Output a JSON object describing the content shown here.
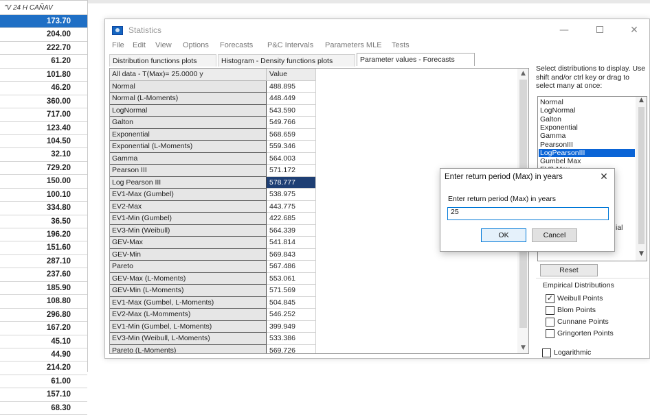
{
  "sheet": {
    "header": "\"V 24 H CAÑAV",
    "cells": [
      "173.70",
      "204.00",
      "222.70",
      "61.20",
      "101.80",
      "46.20",
      "360.00",
      "717.00",
      "123.40",
      "104.50",
      "32.10",
      "729.20",
      "150.00",
      "100.10",
      "334.80",
      "36.50",
      "196.20",
      "151.60",
      "287.10",
      "237.60",
      "185.90",
      "108.80",
      "296.80",
      "167.20",
      "45.10",
      "44.90",
      "214.20",
      "61.00",
      "157.10",
      "68.30"
    ]
  },
  "window": {
    "title": "Statistics",
    "minimize": "—",
    "close": "✕"
  },
  "menu": [
    "File",
    "Edit",
    "View",
    "Options",
    "Forecasts",
    "P&C Intervals",
    "Parameters MLE",
    "Tests"
  ],
  "tabs": [
    "Distribution functions plots",
    "Histogram - Density functions plots",
    "Parameter values - Forecasts"
  ],
  "table": {
    "header_name": "All data - T(Max)= 25.0000 y",
    "header_value": "Value",
    "rows": [
      {
        "name": "Normal",
        "value": "488.895"
      },
      {
        "name": "Normal (L-Moments)",
        "value": "448.449"
      },
      {
        "name": "LogNormal",
        "value": "543.590"
      },
      {
        "name": "Galton",
        "value": "549.766"
      },
      {
        "name": "Exponential",
        "value": "568.659"
      },
      {
        "name": "Exponential (L-Moments)",
        "value": "559.346"
      },
      {
        "name": "Gamma",
        "value": "564.003"
      },
      {
        "name": "Pearson III",
        "value": "571.172"
      },
      {
        "name": "Log Pearson III",
        "value": "578.777"
      },
      {
        "name": "EV1-Max (Gumbel)",
        "value": "538.975"
      },
      {
        "name": "EV2-Max",
        "value": "443.775"
      },
      {
        "name": "EV1-Min (Gumbel)",
        "value": "422.685"
      },
      {
        "name": "EV3-Min (Weibull)",
        "value": "564.339"
      },
      {
        "name": "GEV-Max",
        "value": "541.814"
      },
      {
        "name": "GEV-Min",
        "value": "569.843"
      },
      {
        "name": "Pareto",
        "value": "567.486"
      },
      {
        "name": "GEV-Max (L-Moments)",
        "value": "553.061"
      },
      {
        "name": "GEV-Min (L-Moments)",
        "value": "571.569"
      },
      {
        "name": "EV1-Max (Gumbel, L-Moments)",
        "value": "504.845"
      },
      {
        "name": "EV2-Max (L-Momments)",
        "value": "546.252"
      },
      {
        "name": "EV1-Min (Gumbel, L-Moments)",
        "value": "399.949"
      },
      {
        "name": "EV3-Min (Weibull, L-Moments)",
        "value": "533.386"
      },
      {
        "name": "Pareto (L-Moments)",
        "value": "569.726"
      }
    ],
    "selected_row": "Log Pearson III"
  },
  "right": {
    "select_label": "Select distributions to display. Use shift and/or ctrl key or drag to select many at once:",
    "dist_list": [
      "Normal",
      "LogNormal",
      "Galton",
      "Exponential",
      "Gamma",
      "PearsonIII",
      "LogPearsonIII",
      "Gumbel Max",
      "EV2-Max"
    ],
    "selected_dist": "LogPearsonIII",
    "reset_label": "Reset",
    "empirical_title": "Empirical Distributions",
    "empirical": [
      {
        "label": "Weibull Points",
        "checked": true,
        "mark": "✓"
      },
      {
        "label": "Blom Points",
        "checked": false,
        "mark": ""
      },
      {
        "label": "Cunnane Points",
        "checked": false,
        "mark": ""
      },
      {
        "label": "Gringorten Points",
        "checked": false,
        "mark": ""
      }
    ],
    "logarithmic_label": "Logarithmic",
    "behind_text": "ial"
  },
  "dialog": {
    "title": "Enter return period (Max) in years",
    "close": "✕",
    "prompt": "Enter return period (Max) in years",
    "input_value": "25",
    "ok_label": "OK",
    "cancel_label": "Cancel"
  },
  "colors": {
    "selection_blue": "#1f6fc5",
    "table_selected": "#1e3f74",
    "list_selected": "#0a64d6",
    "accent": "#0078d7"
  }
}
